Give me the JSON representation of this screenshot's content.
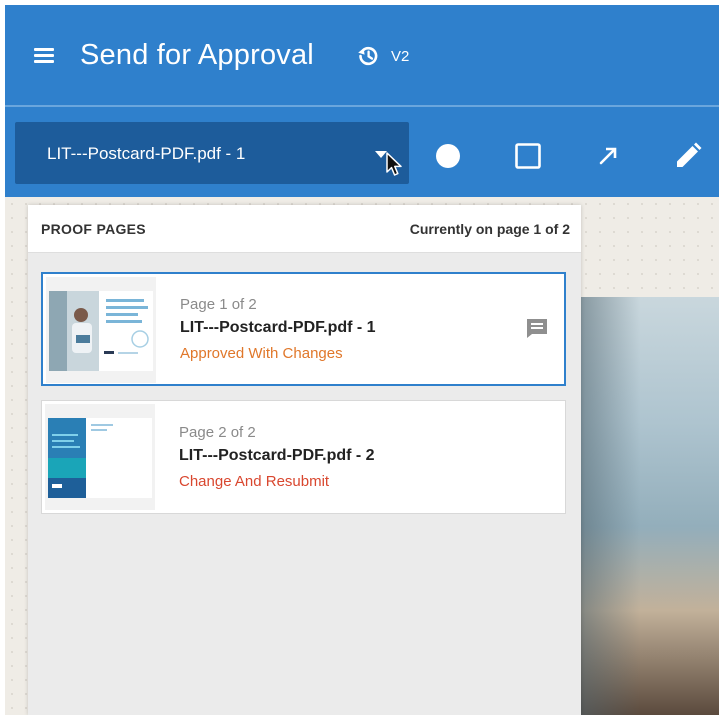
{
  "header": {
    "title": "Send for Approval",
    "version": "V2",
    "menu_icon": "hamburger-menu-icon",
    "history_icon": "history-icon",
    "background": "#2f80cc"
  },
  "toolbar": {
    "document_select": {
      "selected": "LIT---Postcard-PDF.pdf - 1"
    },
    "tools": [
      {
        "name": "circle-tool",
        "icon": "circle-icon"
      },
      {
        "name": "rectangle-tool",
        "icon": "square-icon"
      },
      {
        "name": "arrow-tool",
        "icon": "arrow-icon"
      },
      {
        "name": "pen-tool",
        "icon": "pencil-icon"
      }
    ]
  },
  "proof_pages": {
    "title": "PROOF PAGES",
    "current_status": "Currently on page 1 of 2",
    "pages": [
      {
        "page_label": "Page 1 of 2",
        "file_name": "LIT---Postcard-PDF.pdf - 1",
        "status": "Approved With Changes",
        "status_color": "#e0772a",
        "selected": true,
        "has_comments": true
      },
      {
        "page_label": "Page 2 of 2",
        "file_name": "LIT---Postcard-PDF.pdf - 2",
        "status": "Change And Resubmit",
        "status_color": "#d9472f",
        "selected": false,
        "has_comments": false
      }
    ]
  },
  "colors": {
    "accent": "#2f80cc",
    "select_background": "#1d5c9b",
    "approved_with_changes": "#e0772a",
    "change_and_resubmit": "#d9472f"
  }
}
